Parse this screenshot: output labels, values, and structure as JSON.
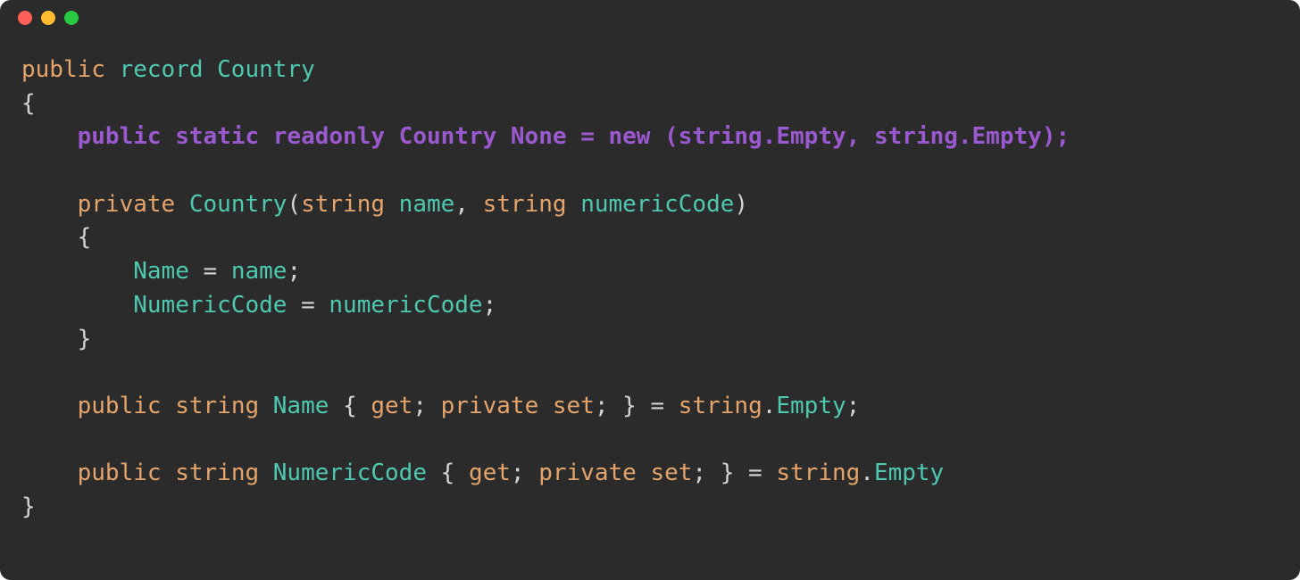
{
  "window": {
    "traffic_lights": [
      "close",
      "minimize",
      "maximize"
    ]
  },
  "code": {
    "l1_public": "public",
    "l1_record": "record",
    "l1_Country": "Country",
    "l2_brace": "{",
    "l3_public": "public",
    "l3_static": "static",
    "l3_readonly": "readonly",
    "l3_Country": "Country",
    "l3_None": "None",
    "l3_eq": "=",
    "l3_new": "new",
    "l3_paren_open": "(",
    "l3_string1": "string",
    "l3_dot1": ".",
    "l3_Empty1": "Empty",
    "l3_comma": ",",
    "l3_string2": "string",
    "l3_dot2": ".",
    "l3_Empty2": "Empty",
    "l3_paren_close": ")",
    "l3_semi": ";",
    "l5_private": "private",
    "l5_Country": "Country",
    "l5_paren_open": "(",
    "l5_string1": "string",
    "l5_name": "name",
    "l5_comma": ",",
    "l5_string2": "string",
    "l5_numericCode": "numericCode",
    "l5_paren_close": ")",
    "l6_brace": "{",
    "l7_Name": "Name",
    "l7_eq": "=",
    "l7_name": "name",
    "l7_semi": ";",
    "l8_NumericCode": "NumericCode",
    "l8_eq": "=",
    "l8_numericCode": "numericCode",
    "l8_semi": ";",
    "l9_brace": "}",
    "l11_public": "public",
    "l11_string": "string",
    "l11_Name": "Name",
    "l11_brace_open": "{",
    "l11_get": "get",
    "l11_semi1": ";",
    "l11_private": "private",
    "l11_set": "set",
    "l11_semi2": ";",
    "l11_brace_close": "}",
    "l11_eq": "=",
    "l11_string2": "string",
    "l11_dot": ".",
    "l11_Empty": "Empty",
    "l11_semi3": ";",
    "l13_public": "public",
    "l13_string": "string",
    "l13_NumericCode": "NumericCode",
    "l13_brace_open": "{",
    "l13_get": "get",
    "l13_semi1": ";",
    "l13_private": "private",
    "l13_set": "set",
    "l13_semi2": ";",
    "l13_brace_close": "}",
    "l13_eq": "=",
    "l13_string2": "string",
    "l13_dot": ".",
    "l13_Empty": "Empty",
    "l14_brace": "}"
  }
}
